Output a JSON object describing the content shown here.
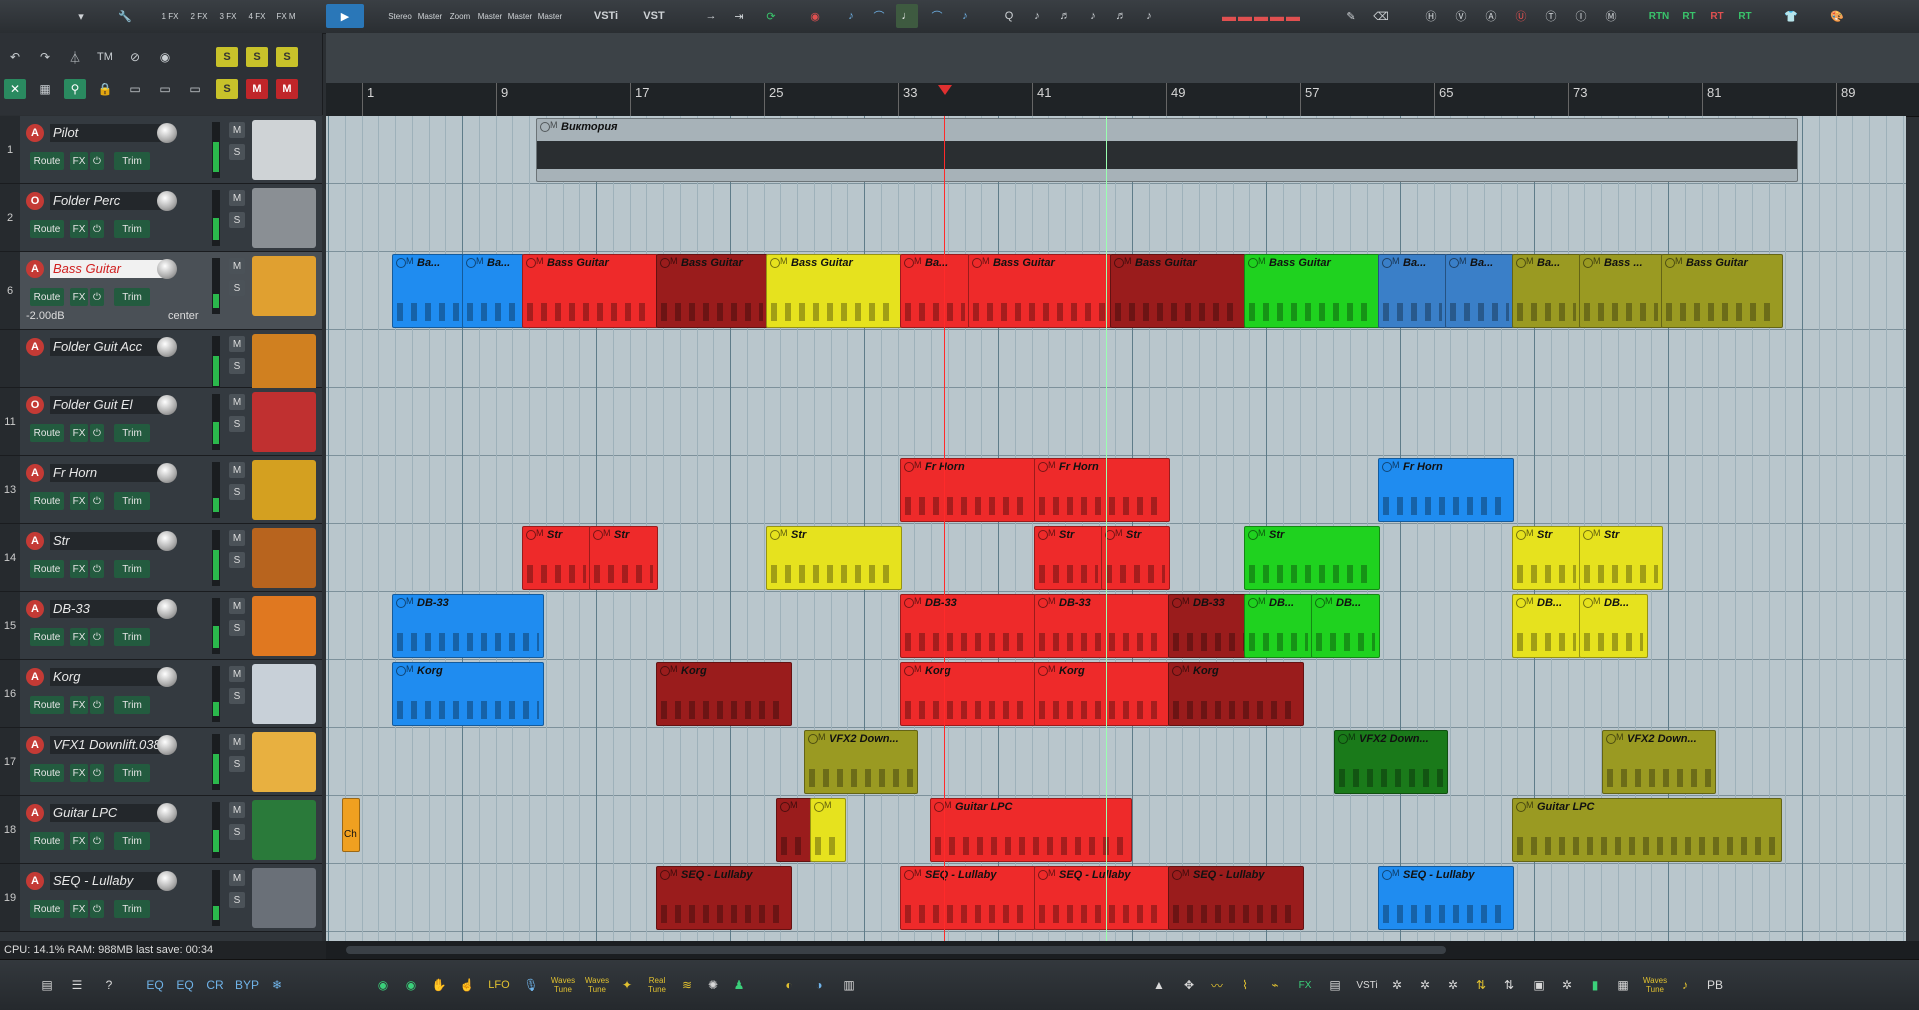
{
  "toolbar": {
    "fx_labels": [
      "1 FX",
      "2 FX",
      "3 FX",
      "4 FX",
      "FX M"
    ],
    "small_labels": [
      "Stereo",
      "Master",
      "Zoom",
      "Master",
      "Master",
      "Master"
    ],
    "vsti": "VSTi",
    "vst": "VST",
    "right_labels": [
      "RTN",
      "RT",
      "RT",
      "RT"
    ]
  },
  "left_ctl": {
    "tm": "TM",
    "s": "S",
    "m": "M"
  },
  "ruler": {
    "bars": [
      "1",
      "9",
      "17",
      "25",
      "33",
      "41",
      "49",
      "57",
      "65",
      "73",
      "81",
      "89"
    ]
  },
  "tracks": [
    {
      "num": "1",
      "name": "Pilot",
      "arm": "A",
      "route": "Route",
      "fx": "FX",
      "trim": "Trim",
      "m": "M",
      "s": "S",
      "thumb_color": "#cfd3d6"
    },
    {
      "num": "2",
      "name": "Folder Perc",
      "arm": "O",
      "route": "Route",
      "fx": "FX",
      "trim": "Trim",
      "m": "M",
      "s": "S",
      "thumb_color": "#8a8f94"
    },
    {
      "num": "6",
      "name": "Bass Guitar",
      "arm": "A",
      "route": "Route",
      "fx": "FX",
      "trim": "Trim",
      "m": "M",
      "s": "S",
      "vol": "-2.00dB",
      "pan": "center",
      "thumb_color": "#e0a030"
    },
    {
      "num": "",
      "name": "Folder Guit Acc",
      "arm": "A",
      "m": "M",
      "s": "S",
      "thumb_color": "#d08020"
    },
    {
      "num": "11",
      "name": "Folder Guit El",
      "arm": "O",
      "route": "Route",
      "fx": "FX",
      "trim": "Trim",
      "m": "M",
      "s": "S",
      "thumb_color": "#c03030"
    },
    {
      "num": "13",
      "name": "Fr Horn",
      "arm": "A",
      "route": "Route",
      "fx": "FX",
      "trim": "Trim",
      "m": "M",
      "s": "S",
      "thumb_color": "#d4a020"
    },
    {
      "num": "14",
      "name": "Str",
      "arm": "A",
      "route": "Route",
      "fx": "FX",
      "trim": "Trim",
      "m": "M",
      "s": "S",
      "thumb_color": "#b8641e"
    },
    {
      "num": "15",
      "name": "DB-33",
      "arm": "A",
      "route": "Route",
      "fx": "FX",
      "trim": "Trim",
      "m": "M",
      "s": "S",
      "thumb_color": "#e07820"
    },
    {
      "num": "16",
      "name": "Korg",
      "arm": "A",
      "route": "Route",
      "fx": "FX",
      "trim": "Trim",
      "m": "M",
      "s": "S",
      "thumb_color": "#c8d0d8"
    },
    {
      "num": "17",
      "name": "VFX1 Downlift.038",
      "arm": "A",
      "route": "Route",
      "fx": "FX",
      "trim": "Trim",
      "m": "M",
      "s": "S",
      "thumb_color": "#e8b040"
    },
    {
      "num": "18",
      "name": "Guitar LPC",
      "arm": "A",
      "route": "Route",
      "fx": "FX",
      "trim": "Trim",
      "m": "M",
      "s": "S",
      "thumb_color": "#2a7a3a"
    },
    {
      "num": "19",
      "name": "SEQ - Lullaby",
      "arm": "A",
      "route": "Route",
      "fx": "FX",
      "trim": "Trim",
      "m": "M",
      "s": "S",
      "thumb_color": "#6a7078"
    }
  ],
  "items": {
    "pilot": "Виктория",
    "bass": "Bass Guitar",
    "bass_short": "Ba...",
    "bass_short2": "Bass ...",
    "frhorn": "Fr Horn",
    "str": "Str",
    "db33": "DB-33",
    "db_short": "DB...",
    "korg": "Korg",
    "vfx": "VFX2 Down...",
    "guitar": "Guitar LPC",
    "seq": "SEQ - Lullaby",
    "marker": "Ch"
  },
  "status": {
    "text": "CPU: 14.1%  RAM: 988MB  last save: 00:34"
  },
  "bottom": {
    "eq1": "EQ",
    "eq2": "EQ",
    "cr": "CR",
    "byp": "BYP",
    "lfo": "LFO",
    "waves1": "Waves Tune",
    "waves2": "Waves Tune",
    "real": "Real Tune",
    "fx": "FX",
    "vsti": "VSTi",
    "pb": "PB"
  }
}
